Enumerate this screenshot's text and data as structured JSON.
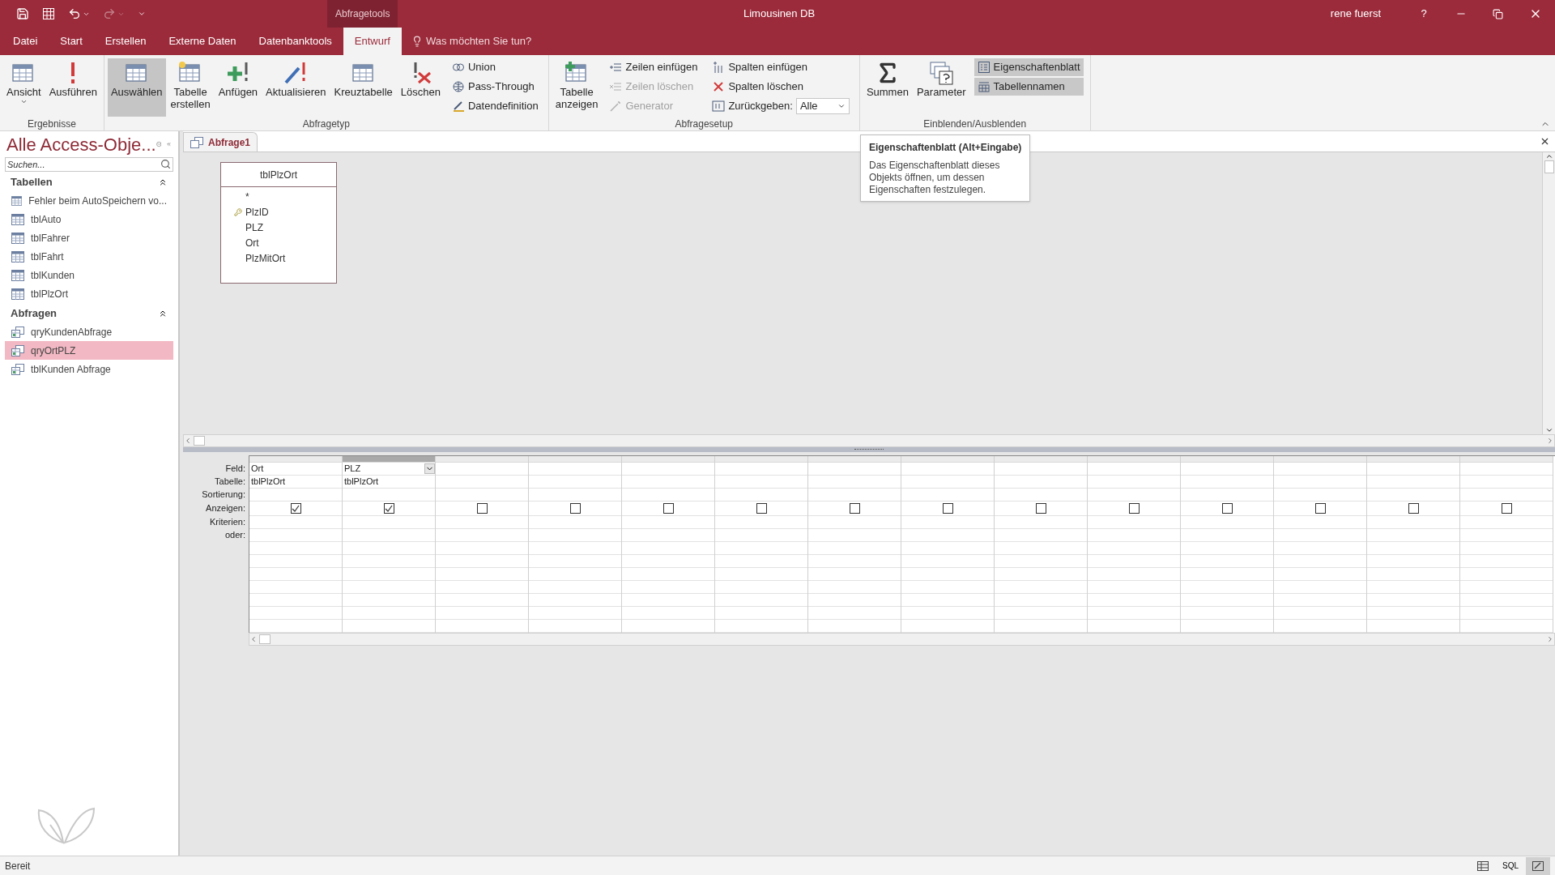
{
  "title_bar": {
    "context_label": "Abfragetools",
    "title": "Limousinen DB",
    "user": "rene fuerst",
    "help": "?"
  },
  "menu_tabs": [
    {
      "label": "Datei",
      "selected": false
    },
    {
      "label": "Start",
      "selected": false
    },
    {
      "label": "Erstellen",
      "selected": false
    },
    {
      "label": "Externe Daten",
      "selected": false
    },
    {
      "label": "Datenbanktools",
      "selected": false
    },
    {
      "label": "Entwurf",
      "selected": true
    }
  ],
  "tell_me": {
    "placeholder": "Was möchten Sie tun?"
  },
  "ribbon_groups": [
    {
      "label": "Ergebnisse",
      "items": [
        {
          "kind": "large",
          "label": "Ansicht",
          "selected": false,
          "dropdown": true
        },
        {
          "kind": "large",
          "label": "Ausführen",
          "selected": false
        }
      ]
    },
    {
      "label": "Abfragetyp",
      "items": [
        {
          "kind": "large",
          "label": "Auswählen",
          "selected": true
        },
        {
          "kind": "large",
          "label": "Tabelle erstellen",
          "selected": false
        },
        {
          "kind": "large",
          "label": "Anfügen",
          "selected": false
        },
        {
          "kind": "large",
          "label": "Aktualisieren",
          "selected": false
        },
        {
          "kind": "large",
          "label": "Kreuztabelle",
          "selected": false
        },
        {
          "kind": "large",
          "label": "Löschen",
          "selected": false
        },
        {
          "kind": "stack",
          "items": [
            {
              "kind": "small",
              "label": "Union",
              "disabled": false,
              "selected": false
            },
            {
              "kind": "small",
              "label": "Pass-Through",
              "disabled": false,
              "selected": false
            },
            {
              "kind": "small",
              "label": "Datendefinition",
              "disabled": false,
              "selected": false
            }
          ]
        }
      ]
    },
    {
      "label": "Abfragesetup",
      "items": [
        {
          "kind": "large",
          "label": "Tabelle anzeigen",
          "selected": false
        },
        {
          "kind": "stack",
          "items": [
            {
              "kind": "small",
              "label": "Zeilen einfügen",
              "disabled": false,
              "selected": false
            },
            {
              "kind": "small",
              "label": "Zeilen löschen",
              "disabled": true,
              "selected": false
            },
            {
              "kind": "small",
              "label": "Generator",
              "disabled": true,
              "selected": false
            }
          ]
        },
        {
          "kind": "stack",
          "items": [
            {
              "kind": "small",
              "label": "Spalten einfügen",
              "disabled": false,
              "selected": false
            },
            {
              "kind": "small",
              "label": "Spalten löschen",
              "disabled": false,
              "selected": false
            },
            {
              "kind": "combo",
              "label": "Zurückgeben:",
              "value": "Alle",
              "disabled": false,
              "selected": false
            }
          ]
        }
      ]
    },
    {
      "label": "Einblenden/Ausblenden",
      "items": [
        {
          "kind": "large",
          "label": "Summen",
          "selected": false
        },
        {
          "kind": "large",
          "label": "Parameter",
          "selected": false
        },
        {
          "kind": "stack",
          "items": [
            {
              "kind": "small",
              "label": "Eigenschaftenblatt",
              "disabled": false,
              "selected": true
            },
            {
              "kind": "small",
              "label": "Tabellennamen",
              "disabled": false,
              "selected": true
            }
          ]
        }
      ]
    }
  ],
  "tooltip": {
    "title": "Eigenschaftenblatt (Alt+Eingabe)",
    "text": "Das Eigenschaftenblatt dieses Objekts öffnen, um dessen Eigenschaften festzulegen."
  },
  "nav_pane": {
    "title": "Alle Access-Obje...",
    "search": {
      "placeholder": "Suchen..."
    },
    "sections": [
      {
        "label": "Tabellen",
        "expanded": true,
        "items": [
          {
            "kind": "table",
            "label": "Fehler beim AutoSpeichern vo...",
            "selected": false
          },
          {
            "kind": "table",
            "label": "tblAuto",
            "selected": false
          },
          {
            "kind": "table",
            "label": "tblFahrer",
            "selected": false
          },
          {
            "kind": "table",
            "label": "tblFahrt",
            "selected": false
          },
          {
            "kind": "table",
            "label": "tblKunden",
            "selected": false
          },
          {
            "kind": "table",
            "label": "tblPlzOrt",
            "selected": false
          }
        ]
      },
      {
        "label": "Abfragen",
        "expanded": true,
        "items": [
          {
            "kind": "query",
            "label": "qryKundenAbfrage",
            "selected": false
          },
          {
            "kind": "query",
            "label": "qryOrtPLZ",
            "selected": true
          },
          {
            "kind": "query",
            "label": "tblKunden Abfrage",
            "selected": false
          }
        ]
      }
    ]
  },
  "document_tabs": [
    {
      "label": "Abfrage1",
      "selected": true
    }
  ],
  "table_box": {
    "title": "tblPlzOrt",
    "fields": [
      {
        "label": "*",
        "primary_key": false
      },
      {
        "label": "PlzID",
        "primary_key": true
      },
      {
        "label": "PLZ",
        "primary_key": false
      },
      {
        "label": "Ort",
        "primary_key": false
      },
      {
        "label": "PlzMitOrt",
        "primary_key": false
      }
    ]
  },
  "design_grid": {
    "row_labels": [
      "Feld:",
      "Tabelle:",
      "Sortierung:",
      "Anzeigen:",
      "Kriterien:",
      "oder:"
    ],
    "columns": [
      {
        "field": "Ort",
        "table": "tblPlzOrt",
        "show": true,
        "selected": false
      },
      {
        "field": "PLZ",
        "table": "tblPlzOrt",
        "show": true,
        "selected": true
      },
      {
        "show": false,
        "selected": false
      },
      {
        "show": false,
        "selected": false
      },
      {
        "show": false,
        "selected": false
      },
      {
        "show": false,
        "selected": false
      },
      {
        "show": false,
        "selected": false
      },
      {
        "show": false,
        "selected": false
      },
      {
        "show": false,
        "selected": false
      },
      {
        "show": false,
        "selected": false
      },
      {
        "show": false,
        "selected": false
      },
      {
        "show": false,
        "selected": false
      },
      {
        "show": false,
        "selected": false
      },
      {
        "show": false,
        "selected": false
      }
    ]
  },
  "status_bar": {
    "text": "Bereit",
    "views": [
      {
        "kind": "datasheet",
        "selected": false
      },
      {
        "kind": "sql",
        "label": "SQL",
        "selected": false
      },
      {
        "kind": "design",
        "selected": true
      }
    ]
  }
}
